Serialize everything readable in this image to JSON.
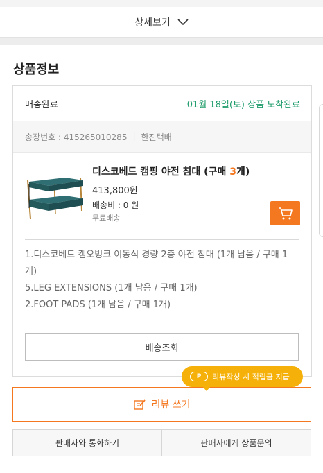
{
  "detail_bar": {
    "label": "상세보기"
  },
  "section": {
    "title": "상품정보"
  },
  "delivery": {
    "status": "배송완료",
    "arrival": "01월 18일(토) 상품 도착완료",
    "tracking_label": "송장번호 : 415265010285",
    "divider": "|",
    "courier": "한진택배"
  },
  "product": {
    "name_prefix": "디스코베드 캠핑 야전 침대 (구매 ",
    "qty": "3",
    "name_suffix": "개)",
    "price": "413,800원",
    "shipping_fee": "배송비 : 0 원",
    "shipping_type": "무료배송"
  },
  "options": [
    "1.디스코베드 캠오벙크 이동식 경량 2층 야전 침대 (1개 남음 / 구매 1개)",
    "5.LEG EXTENSIONS (1개 남음 / 구매 1개)",
    "2.FOOT PADS (1개 남음 / 구매 1개)"
  ],
  "buttons": {
    "track": "배송조회",
    "review": "리뷰 쓰기",
    "call_seller": "판매자와 통화하기",
    "ask_seller": "판매자에게 상품문의"
  },
  "tooltip": {
    "badge": "P",
    "text": "리뷰작성 시 적립금 지급"
  },
  "colors": {
    "accent": "#f47820",
    "status_green": "#1f9c6b",
    "tooltip": "#f5b10a"
  },
  "icons": [
    "chevron-down-icon",
    "cart-icon",
    "edit-icon",
    "point-icon"
  ]
}
